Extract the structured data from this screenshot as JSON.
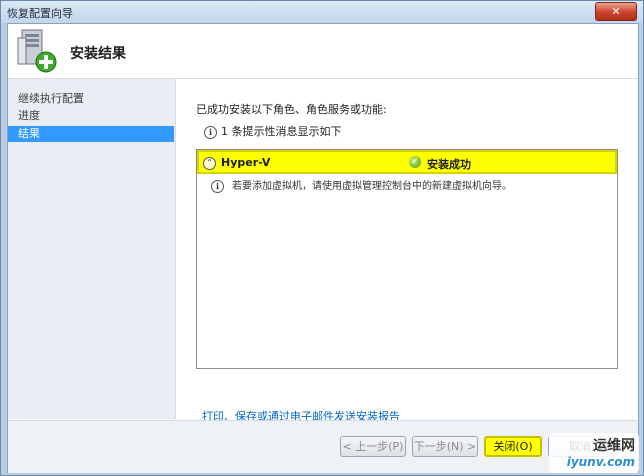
{
  "window": {
    "title": "恢复配置向导",
    "close_label": "✕"
  },
  "header": {
    "title": "安装结果",
    "icon": "server-install-icon"
  },
  "sidebar": {
    "items": [
      {
        "label": "继续执行配置",
        "active": false
      },
      {
        "label": "进度",
        "active": false
      },
      {
        "label": "结果",
        "active": true
      }
    ]
  },
  "main": {
    "intro": "已成功安装以下角色、角色服务或功能:",
    "info_summary": "1 条提示性消息显示如下",
    "results": [
      {
        "role": "Hyper-V",
        "status": "安装成功",
        "detail": "若要添加虚拟机，请使用虚拟管理控制台中的新建虚拟机向导。"
      }
    ],
    "report_link": "打印、保存或通过电子邮件发送安装报告"
  },
  "footer": {
    "prev_label": "< 上一步(P)",
    "next_label": "下一步(N) >",
    "close_label": "关闭(O)",
    "cancel_label": "取消"
  },
  "watermark": {
    "line1": "运维网",
    "line2": "iyunv.com"
  },
  "colors": {
    "highlight": "#ffff00",
    "selection": "#3399ff",
    "link": "#0066cc"
  }
}
